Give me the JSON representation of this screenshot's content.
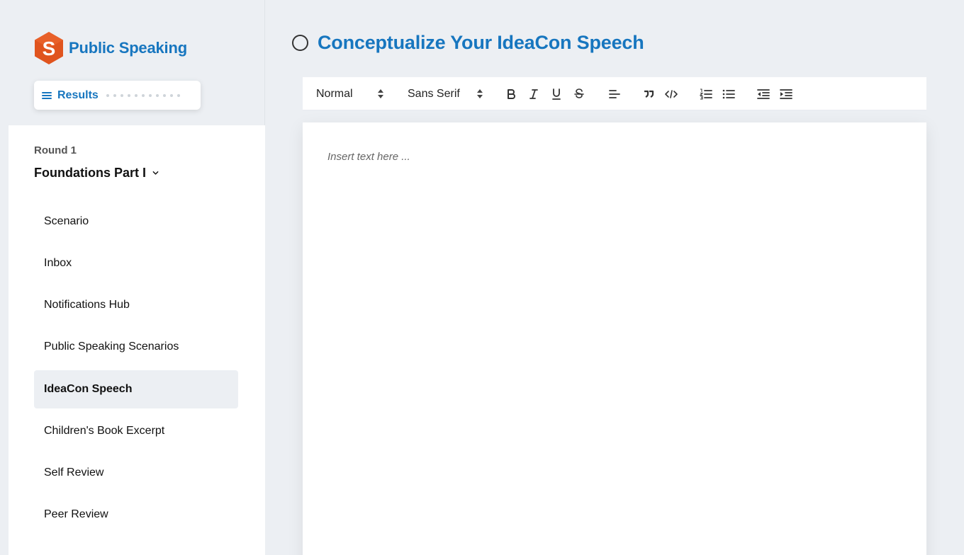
{
  "brand": {
    "title": "Public Speaking",
    "logo_letter": "S",
    "color": "#e0541e"
  },
  "results": {
    "label": "Results",
    "progress_dot_count": 11
  },
  "round": {
    "label": "Round 1",
    "title": "Foundations Part I"
  },
  "nav": {
    "items": [
      {
        "label": "Scenario"
      },
      {
        "label": "Inbox"
      },
      {
        "label": "Notifications Hub"
      },
      {
        "label": "Public Speaking Scenarios"
      },
      {
        "label": "IdeaCon Speech",
        "active": true
      },
      {
        "label": "Children's Book Excerpt"
      },
      {
        "label": "Self Review"
      },
      {
        "label": "Peer Review"
      }
    ]
  },
  "main": {
    "title": "Conceptualize Your IdeaCon Speech",
    "status": "incomplete"
  },
  "toolbar": {
    "format_value": "Normal",
    "font_value": "Sans Serif",
    "buttons": [
      "bold-icon",
      "italic-icon",
      "underline-icon",
      "strikethrough-icon",
      "align-left-icon",
      "blockquote-icon",
      "code-block-icon",
      "ordered-list-icon",
      "bullet-list-icon",
      "outdent-icon",
      "indent-icon"
    ]
  },
  "editor": {
    "placeholder": "Insert text here ..."
  },
  "colors": {
    "accent": "#1776bf",
    "background": "#eceff3",
    "logo": "#e0541e"
  }
}
